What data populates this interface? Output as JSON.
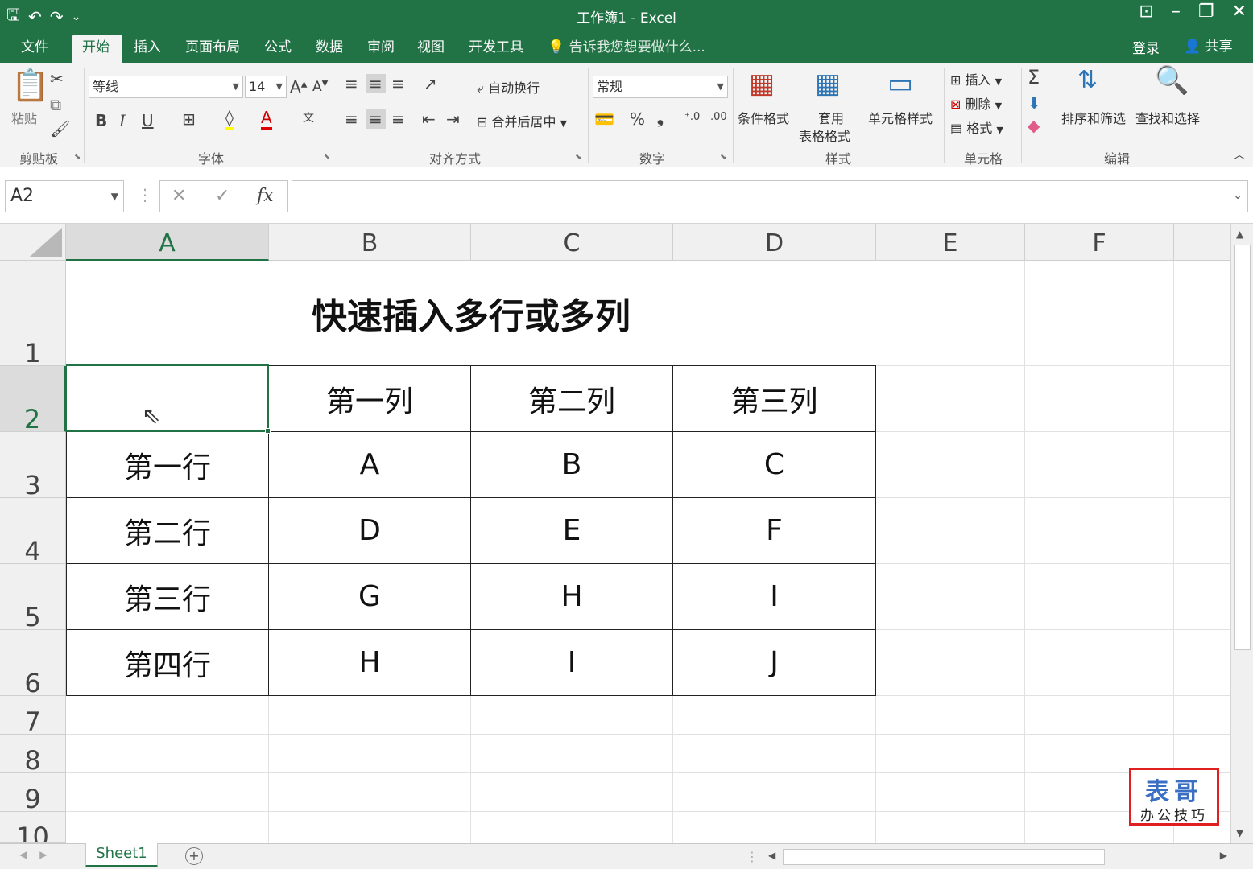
{
  "window": {
    "title": "工作簿1 - Excel"
  },
  "qat": {
    "save": "🖫",
    "undo": "↶",
    "redo": "↷",
    "customize": "⌄"
  },
  "tabs": [
    {
      "label": "文件"
    },
    {
      "label": "开始"
    },
    {
      "label": "插入"
    },
    {
      "label": "页面布局"
    },
    {
      "label": "公式"
    },
    {
      "label": "数据"
    },
    {
      "label": "审阅"
    },
    {
      "label": "视图"
    },
    {
      "label": "开发工具"
    }
  ],
  "tell_me": "告诉我您想要做什么...",
  "account": {
    "login": "登录",
    "share": "共享"
  },
  "ribbon": {
    "clipboard": {
      "label": "剪贴板",
      "paste": "粘贴"
    },
    "font": {
      "label": "字体",
      "name": "等线",
      "size": "14",
      "bold": "B",
      "italic": "I",
      "underline": "U"
    },
    "alignment": {
      "label": "对齐方式",
      "wrap": "自动换行",
      "merge": "合并后居中"
    },
    "number": {
      "label": "数字",
      "format": "常规",
      "percent": "%",
      "comma": "❟",
      "inc": "⁺.0",
      "dec": ".00"
    },
    "styles": {
      "label": "样式",
      "conditional": "条件格式",
      "table_l1": "套用",
      "table_l2": "表格格式",
      "cell_styles": "单元格样式"
    },
    "cells": {
      "label": "单元格",
      "insert": "插入",
      "delete": "删除",
      "format": "格式"
    },
    "editing": {
      "label": "编辑",
      "sort": "排序和筛选",
      "find": "查找和选择"
    }
  },
  "formula_bar": {
    "name_box": "A2",
    "cancel": "✕",
    "enter": "✓",
    "fx": "fx",
    "value": ""
  },
  "columns": [
    "A",
    "B",
    "C",
    "D",
    "E",
    "F"
  ],
  "rows": [
    "1",
    "2",
    "3",
    "4",
    "5",
    "6",
    "7",
    "8",
    "9",
    "10"
  ],
  "sheet": {
    "title": "快速插入多行或多列",
    "header": [
      "",
      "第一列",
      "第二列",
      "第三列"
    ],
    "body": [
      [
        "第一行",
        "A",
        "B",
        "C"
      ],
      [
        "第二行",
        "D",
        "E",
        "F"
      ],
      [
        "第三行",
        "G",
        "H",
        "I"
      ],
      [
        "第四行",
        "H",
        "I",
        "J"
      ]
    ]
  },
  "sheet_tabs": [
    {
      "label": "Sheet1"
    }
  ],
  "logo": {
    "line1": "表哥",
    "line2": "办公技巧"
  },
  "colors": {
    "excel_green": "#217346",
    "logo_red": "#e02020",
    "logo_blue": "#3b6fc4"
  }
}
